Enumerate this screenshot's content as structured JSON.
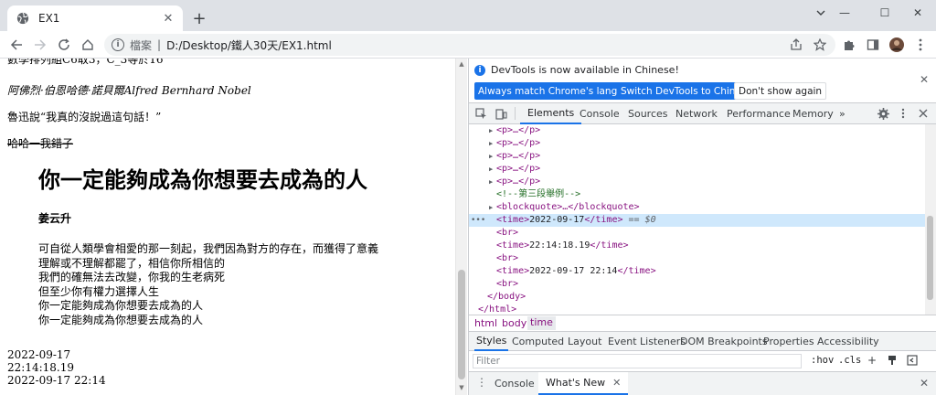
{
  "browser": {
    "tab_title": "EX1",
    "tab_close": "✕",
    "new_tab": "+",
    "win_min": "—",
    "win_max": "☐",
    "win_close": "✕",
    "omnibox_info": "i",
    "omnibox_security": "檔案",
    "omnibox_sep": "|",
    "url": "D:/Desktop/鐵人30天/EX1.html"
  },
  "page": {
    "cut_line": "數學排列組C6取3，C_3等於16",
    "italic_line": "阿佛烈·伯恩哈德·諾貝爾Alfred Bernhard Nobel",
    "quote_line": "魯迅說“我真的沒說過這句話！”",
    "strike_line": "哈哈一我錯子",
    "bq_title": "你一定能夠成為你想要去成為的人",
    "bq_author": "姜云升",
    "poem": [
      "可自從人類學會相愛的那一刻起，我們因為對方的存在，而獲得了意義",
      "理解或不理解都罷了，相信你所相信的",
      "我們的確無法去改變，你我的生老病死",
      "但至少你有權力選擇人生",
      "你一定能夠成為你想要去成為的人",
      "你一定能夠成為你想要去成為的人"
    ],
    "times": [
      "2022-09-17",
      "22:14:18.19",
      "2022-09-17 22:14"
    ]
  },
  "devtools": {
    "banner_info": "i",
    "banner": "DevTools is now available in Chinese!",
    "banner_close": "✕",
    "btn_match": "Always match Chrome's language",
    "btn_switch": "Switch DevTools to Chinese",
    "btn_dont": "Don't show again",
    "tabs": {
      "elements": "Elements",
      "console": "Console",
      "sources": "Sources",
      "network": "Network",
      "performance": "Performance",
      "memory": "Memory",
      "more": "»"
    },
    "dom": {
      "p": "<p>…</p>",
      "comment": "<!--第三段舉例-->",
      "blockquote": "<blockquote>…</blockquote>",
      "ellipsis": "•••",
      "time_open": "<time>",
      "time_close": "</time>",
      "sel_value": "2022-09-17",
      "eq": "== $0",
      "br": "<br>",
      "time2": "22:14:18.19",
      "time3": "2022-09-17 22:14",
      "body_close": "</body>",
      "html_close": "</html>"
    },
    "crumbs": [
      "html",
      "body",
      "time"
    ],
    "subtabs": [
      "Styles",
      "Computed",
      "Layout",
      "Event Listeners",
      "DOM Breakpoints",
      "Properties",
      "Accessibility"
    ],
    "filter_placeholder": "Filter",
    "hov": ":hov",
    "cls": ".cls",
    "plus": "+",
    "drawer_console": "Console",
    "drawer_whatsnew": "What's New",
    "drawer_x": "✕",
    "drawer_close": "✕"
  }
}
